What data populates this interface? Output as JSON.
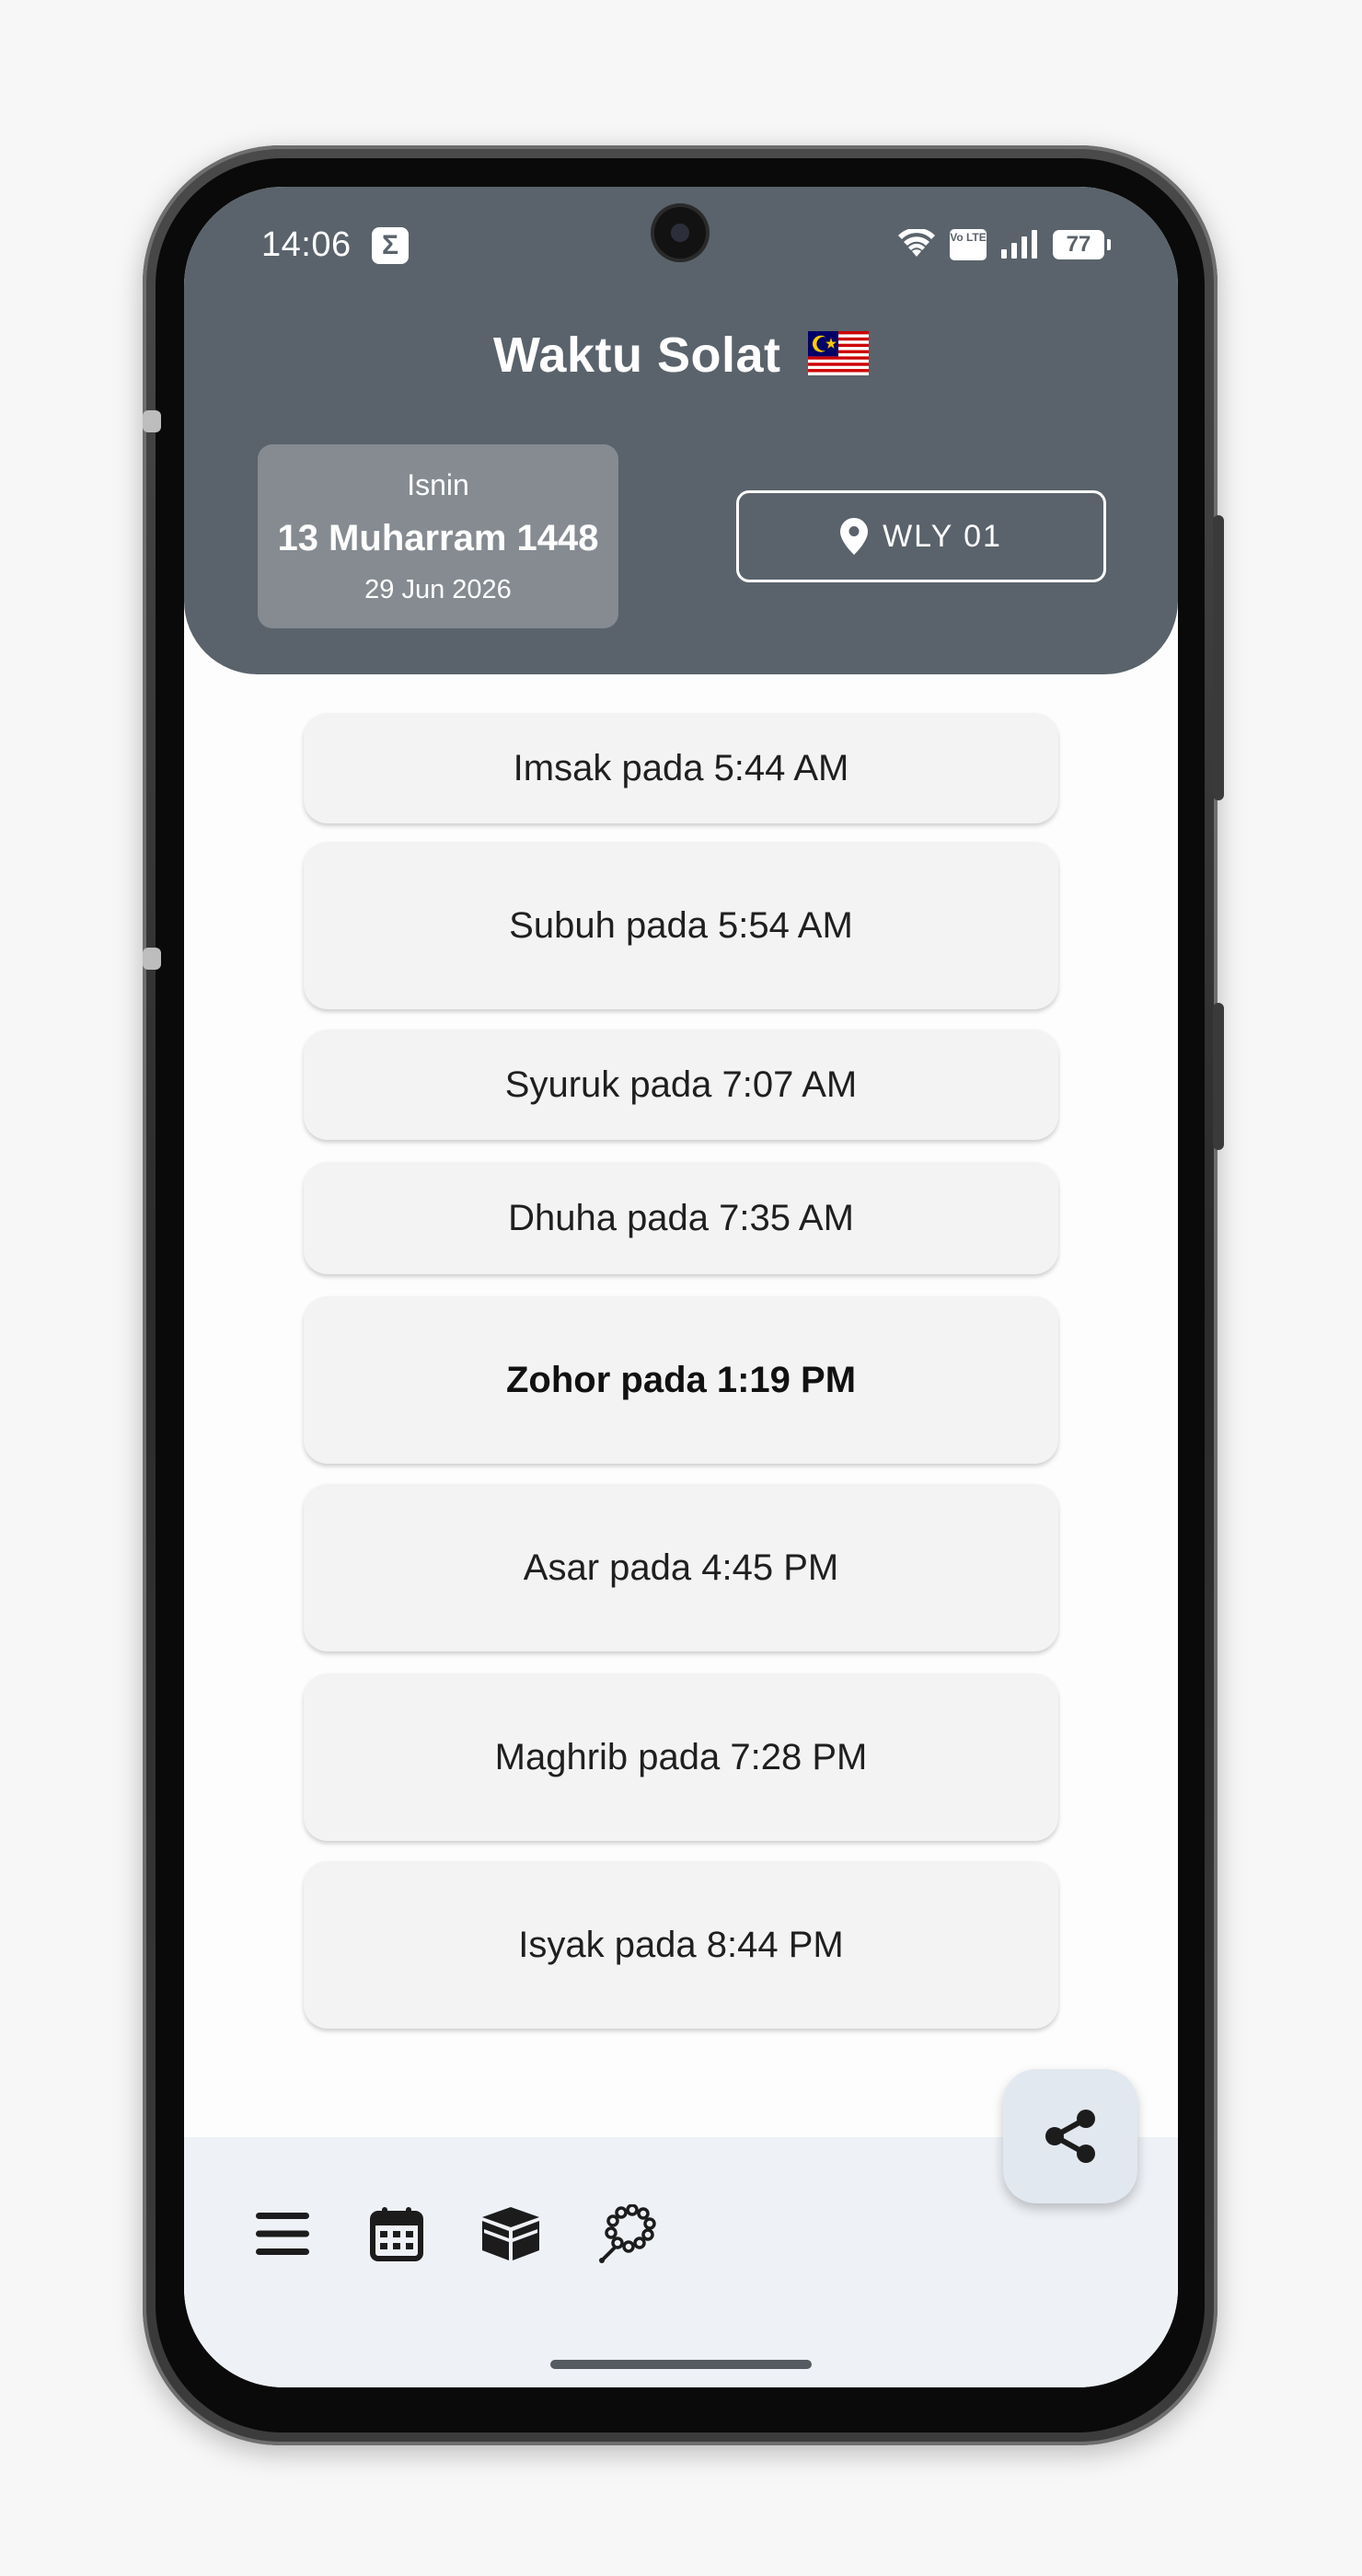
{
  "status_bar": {
    "time": "14:06",
    "notification_glyph": "Σ",
    "volte_label": "Vo LTE",
    "battery": "77"
  },
  "header": {
    "title": "Waktu Solat",
    "flag_icon": "malaysia-flag-icon",
    "date": {
      "day": "Isnin",
      "hijri": "13 Muharram 1448",
      "gregorian": "29 Jun 2026"
    },
    "zone_label": "WLY 01"
  },
  "prayers": [
    {
      "label": "Imsak pada 5:44 AM",
      "current": false
    },
    {
      "label": "Subuh pada 5:54 AM",
      "current": false
    },
    {
      "label": "Syuruk pada 7:07 AM",
      "current": false
    },
    {
      "label": "Dhuha pada 7:35 AM",
      "current": false
    },
    {
      "label": "Zohor pada 1:19 PM",
      "current": true
    },
    {
      "label": "Asar pada 4:45 PM",
      "current": false
    },
    {
      "label": "Maghrib pada 7:28 PM",
      "current": false
    },
    {
      "label": "Isyak pada 8:44 PM",
      "current": false
    }
  ],
  "bottom_nav": {
    "items": [
      "menu-icon",
      "calendar-icon",
      "kaaba-icon",
      "tasbih-icon"
    ],
    "fab_icon": "share-icon"
  },
  "colors": {
    "header_bg": "#5a636b",
    "date_card_bg": "#858b91",
    "card_bg": "#f3f3f3",
    "bottom_bar_bg": "#eef1f6",
    "fab_bg": "#e2e8ef"
  }
}
